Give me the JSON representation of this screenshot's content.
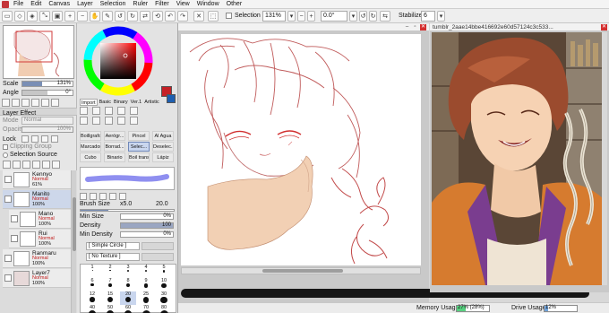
{
  "menubar": {
    "items": [
      "File",
      "Edit",
      "Canvas",
      "Layer",
      "Selection",
      "Ruler",
      "Filter",
      "View",
      "Window",
      "Other"
    ]
  },
  "toolbar": {
    "selection_label": "Selection",
    "zoom_value": "131%",
    "angle_value": "0.0°",
    "stabilizer_label": "Stabilizer",
    "stabilizer_value": "6"
  },
  "navigator": {
    "scale_label": "Scale",
    "scale_value": "131%",
    "angle_label": "Angle",
    "angle_value": "0°"
  },
  "layer_panel": {
    "effect_label": "Layer Effect",
    "mode_label": "Mode",
    "mode_value": "Normal",
    "opacity_label": "Opacity",
    "opacity_value": "100%",
    "lock_label": "Lock",
    "clipping_label": "Clipping Group",
    "selection_source_label": "Selection Source",
    "layers": [
      {
        "name": "Kennyo",
        "mode": "Normal",
        "opacity": "61%"
      },
      {
        "name": "Manito",
        "mode": "Normal",
        "opacity": "100%"
      },
      {
        "name": "Mano",
        "mode": "Normal",
        "opacity": "100%"
      },
      {
        "name": "Rui",
        "mode": "Normal",
        "opacity": "100%"
      },
      {
        "name": "Ranmaru",
        "mode": "Normal",
        "opacity": "100%"
      },
      {
        "name": "Layer7",
        "mode": "Normal",
        "opacity": "100%"
      }
    ]
  },
  "color_panel": {
    "primary_color": "#c42026",
    "secondary_color": "#1e5fb0",
    "tabs": [
      "Import",
      "Basic",
      "Binary",
      "Ver.1",
      "Artistic"
    ]
  },
  "tools": {
    "cells": [
      "Boillgrafo",
      "Aerógr...",
      "Pincel",
      "Al Agua",
      "Marcador",
      "Borrad...",
      "Selec...",
      "Deselec...",
      "Cubo",
      "Binario",
      "Boil trans",
      "Lápiz"
    ],
    "brush_size_label": "Brush Size",
    "brush_size_mult": "x5.0",
    "brush_size_value": "20.0",
    "min_size_label": "Min Size",
    "min_size_value": "0%",
    "density_label": "Density",
    "density_value": "100",
    "min_density_label": "Min Density",
    "min_density_value": "0%",
    "shape_label": "[ Simple Circle ]",
    "texture_label": "[ No Texture ]",
    "dot_sizes": [
      "1",
      "2",
      "3",
      "4",
      "5",
      "6",
      "7",
      "8",
      "9",
      "10",
      "12",
      "15",
      "20",
      "25",
      "30",
      "40",
      "50",
      "60",
      "70",
      "80"
    ]
  },
  "ref_window": {
    "title": "tumblr_2aae14bbe416692e60d57124c3c533..."
  },
  "status": {
    "memory_label": "Memory Usage",
    "memory_value": "27% (28%)",
    "memory_fraction": 0.27,
    "drive_label": "Drive Usage",
    "drive_value": "12%",
    "drive_fraction": 0.12
  }
}
